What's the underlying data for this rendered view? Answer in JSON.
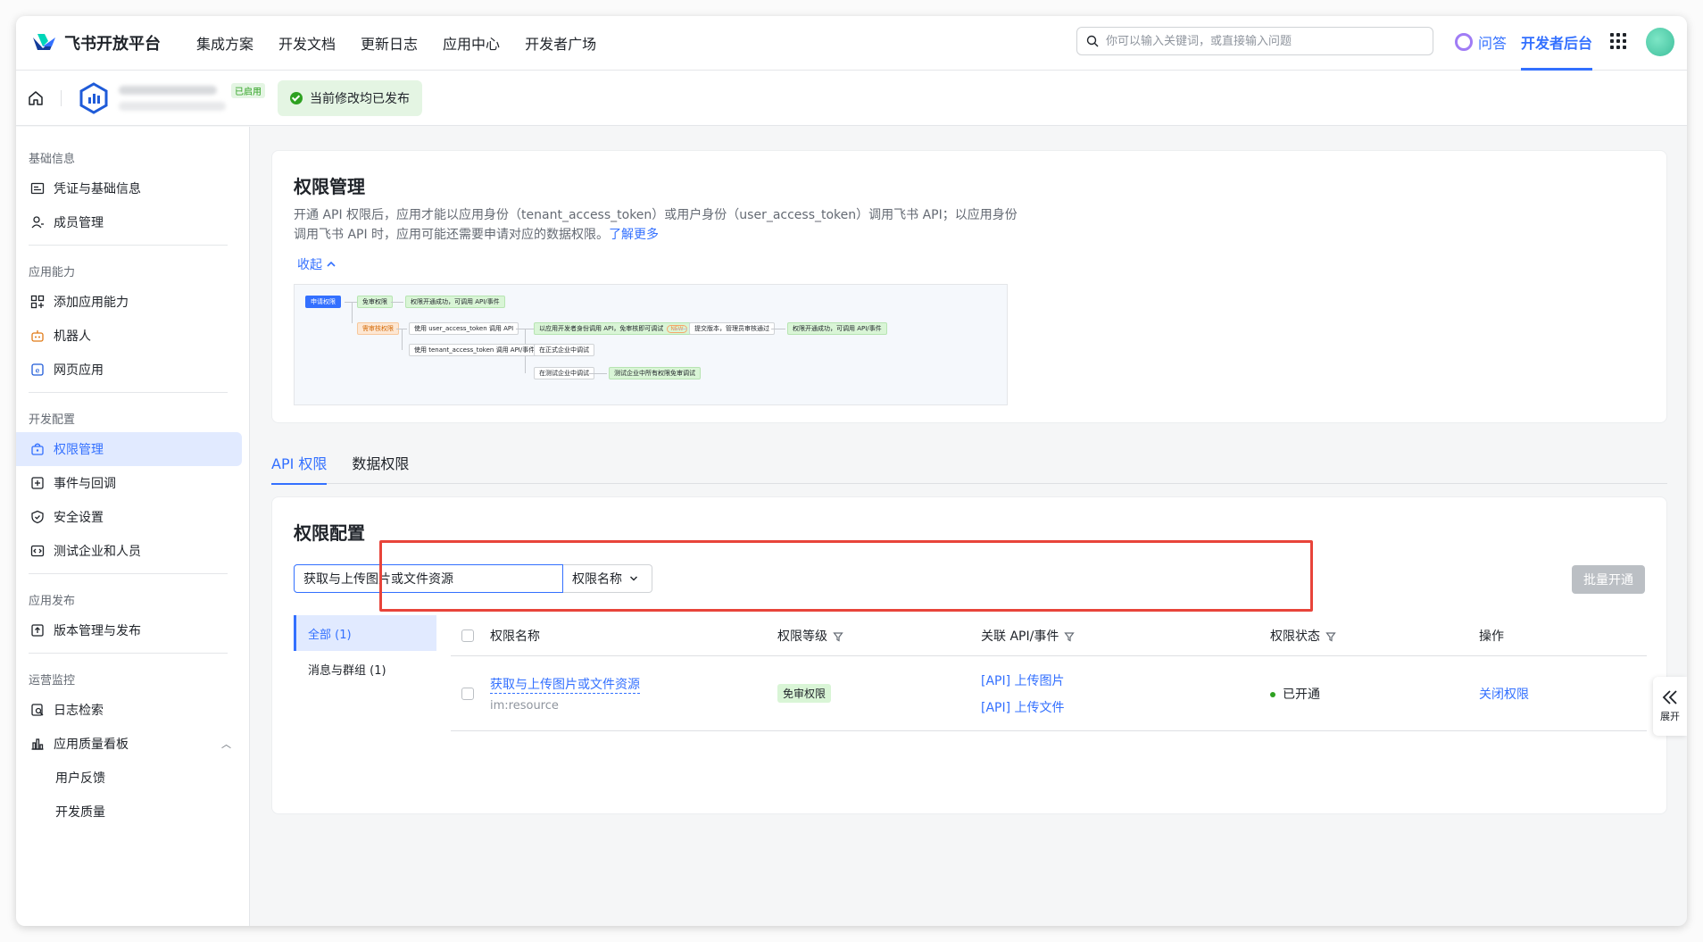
{
  "brand": {
    "title": "飞书开放平台"
  },
  "nav": {
    "items": [
      "集成方案",
      "开发文档",
      "更新日志",
      "应用中心",
      "开发者广场"
    ],
    "search_placeholder": "你可以输入关键词，或直接输入问题",
    "qa_label": "问答",
    "dev_console_label": "开发者后台"
  },
  "subheader": {
    "enabled_badge": "已启用",
    "published_status": "当前修改均已发布"
  },
  "sidebar": {
    "groups": [
      {
        "title": "基础信息",
        "items": [
          "凭证与基础信息",
          "成员管理"
        ]
      },
      {
        "title": "应用能力",
        "items": [
          "添加应用能力",
          "机器人",
          "网页应用"
        ]
      },
      {
        "title": "开发配置",
        "items": [
          "权限管理",
          "事件与回调",
          "安全设置",
          "测试企业和人员"
        ]
      },
      {
        "title": "应用发布",
        "items": [
          "版本管理与发布"
        ]
      },
      {
        "title": "运营监控",
        "items": [
          "日志检索",
          "应用质量看板",
          "用户反馈",
          "开发质量"
        ]
      }
    ]
  },
  "intro": {
    "title": "权限管理",
    "desc_line1": "开通 API 权限后，应用才能以应用身份（tenant_access_token）或用户身份（user_access_token）调用飞书 API；以应用身份",
    "desc_line2": "调用飞书 API 时，应用可能还需要申请对应的数据权限。",
    "learn_more": "了解更多",
    "collapse": "收起",
    "flow": {
      "apply": "申请权限",
      "free": "免审权限",
      "free_done": "权限开通成功，可调用 API/事件",
      "review": "需审核权限",
      "use_user": "使用 user_access_token 调用 API",
      "dev_debug": "以应用开发者身份调用 API，免审核即可调试",
      "new": "NEW",
      "submit": "提交版本，管理员审核通过",
      "review_done": "权限开通成功，可调用 API/事件",
      "use_tenant": "使用 tenant_access_token 调用 API/事件",
      "formal": "在正式企业中调试",
      "test": "在测试企业中调试",
      "test_free": "测试企业中所有权限免审调试"
    }
  },
  "tabs": [
    "API 权限",
    "数据权限"
  ],
  "config": {
    "title": "权限配置",
    "search_value": "获取与上传图片或文件资源",
    "select_label": "权限名称",
    "bulk_button": "批量开通",
    "categories": [
      "全部 (1)",
      "消息与群组 (1)"
    ],
    "columns": [
      "权限名称",
      "权限等级",
      "关联 API/事件",
      "权限状态",
      "操作"
    ],
    "rows": [
      {
        "name": "获取与上传图片或文件资源",
        "code": "im:resource",
        "level": "免审权限",
        "apis": [
          "[API] 上传图片",
          "[API] 上传文件"
        ],
        "status": "已开通",
        "action": "关闭权限"
      }
    ]
  },
  "expand": {
    "label": "展开"
  }
}
